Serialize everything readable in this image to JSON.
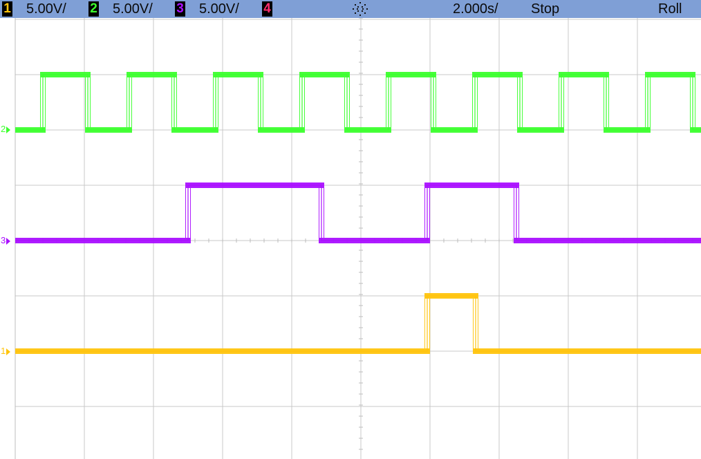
{
  "status_bar": {
    "channels": [
      {
        "number": "1",
        "scale": "5.00V/",
        "color": "#ffc40d"
      },
      {
        "number": "2",
        "scale": "5.00V/",
        "color": "#3cff2e"
      },
      {
        "number": "3",
        "scale": "5.00V/",
        "color": "#aa10ff"
      },
      {
        "number": "4",
        "scale": "",
        "color": "#ff2d6e"
      }
    ],
    "trigger_icon": "trigger-mode-icon",
    "timebase": "2.000s/",
    "run_state": "Stop",
    "mode": "Roll"
  },
  "traces": {
    "ch2": {
      "color": "#3cff2e",
      "low_level_div": 2.0,
      "high_level_div": 3.0,
      "high_intervals_div": [
        [
          0.4,
          1.05
        ],
        [
          1.65,
          2.3
        ],
        [
          2.9,
          3.55
        ],
        [
          4.15,
          4.8
        ],
        [
          5.4,
          6.05
        ],
        [
          6.65,
          7.3
        ],
        [
          7.9,
          8.55
        ],
        [
          9.15,
          9.8
        ]
      ]
    },
    "ch3": {
      "color": "#aa10ff",
      "low_level_div": 0.0,
      "high_level_div": 1.0,
      "high_intervals_div": [
        [
          2.5,
          4.43
        ],
        [
          5.96,
          7.25
        ]
      ]
    },
    "ch1": {
      "color": "#ffc40d",
      "low_level_div": -2.0,
      "high_level_div": -1.0,
      "high_intervals_div": [
        [
          5.96,
          6.66
        ]
      ]
    }
  },
  "markers": [
    {
      "label": "2",
      "color": "#3cff2e"
    },
    {
      "label": "3",
      "color": "#aa10ff"
    },
    {
      "label": "1",
      "color": "#ffc40d"
    }
  ]
}
